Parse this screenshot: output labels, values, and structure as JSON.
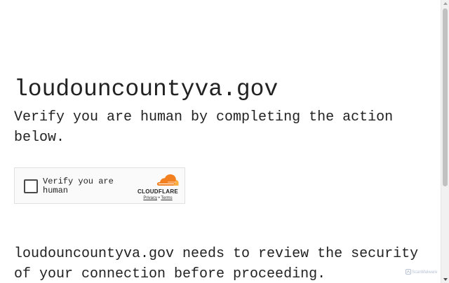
{
  "page": {
    "domain_title": "loudouncountyva.gov",
    "verify_text": "Verify you are human by completing the action below.",
    "review_text": "loudouncountyva.gov needs to review the security of your connection before proceeding."
  },
  "widget": {
    "checkbox_label": "Verify you are human",
    "brand": "CLOUDFLARE",
    "privacy_link": "Privacy",
    "separator": "•",
    "terms_link": "Terms",
    "logo_icon": "cloudflare-cloud-icon",
    "colors": {
      "cloud_orange": "#f38020",
      "cloud_light": "#faae40"
    }
  },
  "watermark": {
    "text": "ScanMalware",
    "icon": "scanmalware-logo-icon"
  }
}
